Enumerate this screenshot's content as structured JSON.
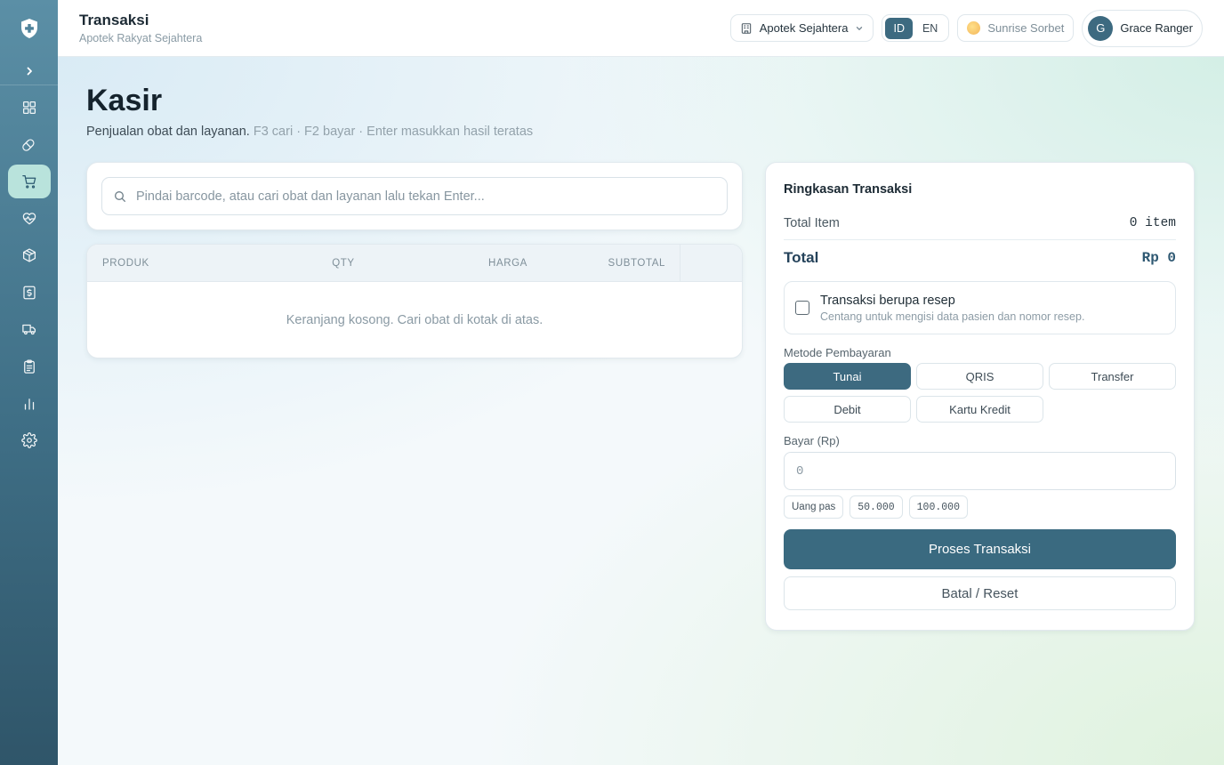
{
  "topbar": {
    "title": "Transaksi",
    "subtitle": "Apotek Rakyat Sejahtera",
    "store_selector": "Apotek Sejahtera",
    "lang_id": "ID",
    "lang_en": "EN",
    "theme": "Sunrise Sorbet",
    "user_initial": "G",
    "user_name": "Grace Ranger"
  },
  "sidebar": {
    "items": [
      {
        "icon": "dashboard-icon",
        "active": false
      },
      {
        "icon": "pill-icon",
        "active": false
      },
      {
        "icon": "cart-icon",
        "active": true
      },
      {
        "icon": "heart-pulse-icon",
        "active": false
      },
      {
        "icon": "package-icon",
        "active": false
      },
      {
        "icon": "dollar-icon",
        "active": false
      },
      {
        "icon": "truck-icon",
        "active": false
      },
      {
        "icon": "clipboard-icon",
        "active": false
      },
      {
        "icon": "chart-icon",
        "active": false
      },
      {
        "icon": "gear-icon",
        "active": false
      }
    ]
  },
  "page": {
    "title": "Kasir",
    "subtitle": "Penjualan obat dan layanan.",
    "hint": "F3 cari · F2 bayar · Enter masukkan hasil teratas"
  },
  "search": {
    "placeholder": "Pindai barcode, atau cari obat dan layanan lalu tekan Enter...",
    "value": ""
  },
  "cart": {
    "columns": [
      "PRODUK",
      "QTY",
      "HARGA",
      "SUBTOTAL"
    ],
    "rows": [],
    "empty_text": "Keranjang kosong. Cari obat di kotak di atas."
  },
  "summary": {
    "title": "Ringkasan Transaksi",
    "total_item_label": "Total Item",
    "total_item_value": "0 item",
    "total_label": "Total",
    "total_value": "Rp 0",
    "prescription_title": "Transaksi berupa resep",
    "prescription_sub": "Centang untuk mengisi data pasien dan nomor resep.",
    "prescription_checked": false,
    "payment_label": "Metode Pembayaran",
    "payment_methods": [
      "Tunai",
      "QRIS",
      "Transfer",
      "Debit",
      "Kartu Kredit"
    ],
    "payment_selected": "Tunai",
    "pay_label": "Bayar (Rp)",
    "pay_placeholder": "0",
    "pay_value": "",
    "quick_amounts": [
      "Uang pas",
      "50.000",
      "100.000"
    ],
    "process_label": "Proses Transaksi",
    "reset_label": "Batal / Reset"
  },
  "colors": {
    "primary": "#3d6a80",
    "active_nav": "#b9e3dc"
  }
}
